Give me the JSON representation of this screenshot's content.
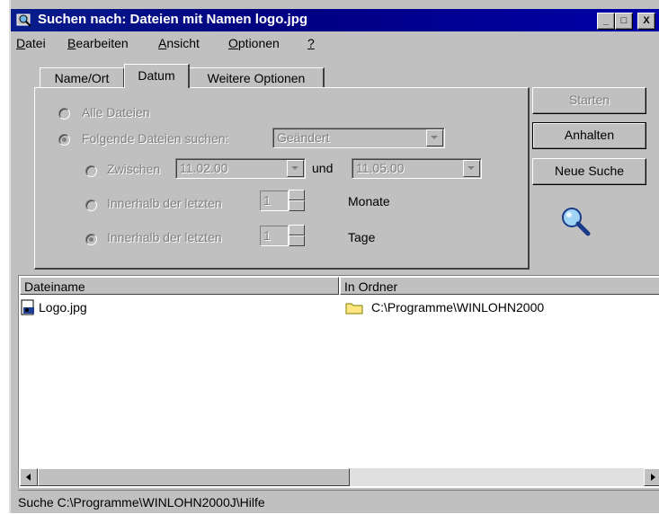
{
  "window": {
    "title": "Suchen nach: Dateien mit Namen logo.jpg",
    "minimize_glyph": "_",
    "maximize_glyph": "□",
    "close_glyph": "X"
  },
  "menu": {
    "items": [
      {
        "label": "Datei",
        "accel": "D",
        "rest": "atei"
      },
      {
        "label": "Bearbeiten",
        "accel": "B",
        "rest": "earbeiten"
      },
      {
        "label": "Ansicht",
        "accel": "A",
        "rest": "nsicht"
      },
      {
        "label": "Optionen",
        "accel": "O",
        "rest": "ptionen"
      },
      {
        "label": "?",
        "accel": "?",
        "rest": ""
      }
    ]
  },
  "tabs": [
    {
      "label": "Name/Ort"
    },
    {
      "label": "Datum",
      "selected": true
    },
    {
      "label": "Weitere Optionen"
    }
  ],
  "datum": {
    "all_files": "Alle Dateien",
    "following_files": "Folgende Dateien suchen:",
    "type_combo_value": "Geändert",
    "between": "Zwischen",
    "date_from": "11.02.00",
    "and": "und",
    "date_to": "11.05.00",
    "within_last_months_label": "Innerhalb der letzten",
    "months_value": "1",
    "months_unit": "Monate",
    "within_last_days_label": "Innerhalb der letzten",
    "days_value": "1",
    "days_unit": "Tage"
  },
  "buttons": {
    "start": "Starten",
    "stop": "Anhalten",
    "new_search": "Neue Suche"
  },
  "results": {
    "columns": [
      "Dateiname",
      "In Ordner"
    ],
    "rows": [
      {
        "name": "Logo.jpg",
        "folder": "C:\\Programme\\WINLOHN2000"
      }
    ]
  },
  "status": {
    "text": "Suche C:\\Programme\\WINLOHN2000J\\Hilfe"
  },
  "colors": {
    "title_bar": "#000080",
    "face": "#c0c0c0"
  },
  "icons": {
    "app": "search-window-icon",
    "search_animation": "magnifier-icon",
    "file": "image-file-icon",
    "folder": "folder-icon"
  }
}
